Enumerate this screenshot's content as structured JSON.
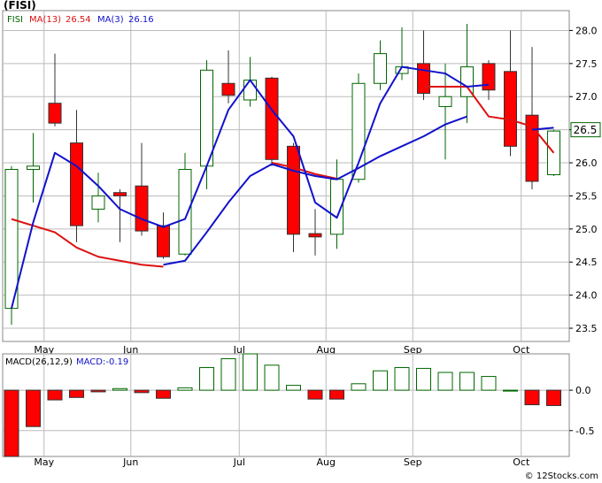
{
  "chart_data": [
    {
      "type": "candlestick",
      "title": "(FISI)",
      "legend": {
        "symbol": "FISI",
        "ma13_label": "MA(13)",
        "ma13_value": "26.54",
        "ma3_label": "MA(3)",
        "ma3_value": "26.16"
      },
      "last_price_label": "26.5",
      "ylim": [
        23.3,
        28.3
      ],
      "y_ticks": [
        {
          "value": 23.5,
          "label": "23.5"
        },
        {
          "value": 24.0,
          "label": "24.0"
        },
        {
          "value": 24.5,
          "label": "24.5"
        },
        {
          "value": 25.0,
          "label": "25.0"
        },
        {
          "value": 25.5,
          "label": "25.5"
        },
        {
          "value": 26.0,
          "label": "26.0"
        },
        {
          "value": 26.5,
          "label": "26.5"
        },
        {
          "value": 27.0,
          "label": "27.0"
        },
        {
          "value": 27.5,
          "label": "27.5"
        },
        {
          "value": 28.0,
          "label": "28.0"
        }
      ],
      "x_labels": [
        {
          "label": "May",
          "index": 1
        },
        {
          "label": "Jun",
          "index": 5
        },
        {
          "label": "Jul",
          "index": 10
        },
        {
          "label": "Aug",
          "index": 14
        },
        {
          "label": "Sep",
          "index": 18
        },
        {
          "label": "Oct",
          "index": 23
        }
      ],
      "candles": [
        {
          "o": 23.8,
          "h": 25.95,
          "l": 23.55,
          "c": 25.9
        },
        {
          "o": 25.9,
          "h": 26.45,
          "l": 25.4,
          "c": 25.95
        },
        {
          "o": 26.9,
          "h": 27.65,
          "l": 26.55,
          "c": 26.6
        },
        {
          "o": 26.3,
          "h": 26.8,
          "l": 24.8,
          "c": 25.05
        },
        {
          "o": 25.3,
          "h": 25.85,
          "l": 25.1,
          "c": 25.5
        },
        {
          "o": 25.55,
          "h": 25.6,
          "l": 24.8,
          "c": 25.5
        },
        {
          "o": 25.65,
          "h": 26.3,
          "l": 24.9,
          "c": 24.97
        },
        {
          "o": 25.05,
          "h": 25.25,
          "l": 24.55,
          "c": 24.58
        },
        {
          "o": 24.62,
          "h": 26.15,
          "l": 24.6,
          "c": 25.9
        },
        {
          "o": 25.95,
          "h": 27.55,
          "l": 25.6,
          "c": 27.4
        },
        {
          "o": 27.2,
          "h": 27.7,
          "l": 26.9,
          "c": 27.02
        },
        {
          "o": 26.95,
          "h": 27.6,
          "l": 26.85,
          "c": 27.25
        },
        {
          "o": 27.28,
          "h": 27.3,
          "l": 25.95,
          "c": 26.05
        },
        {
          "o": 26.25,
          "h": 26.3,
          "l": 24.65,
          "c": 24.92
        },
        {
          "o": 24.93,
          "h": 25.3,
          "l": 24.6,
          "c": 24.88
        },
        {
          "o": 24.92,
          "h": 26.05,
          "l": 24.7,
          "c": 25.75
        },
        {
          "o": 25.75,
          "h": 27.35,
          "l": 25.7,
          "c": 27.2
        },
        {
          "o": 27.2,
          "h": 27.85,
          "l": 27.1,
          "c": 27.65
        },
        {
          "o": 27.35,
          "h": 28.05,
          "l": 27.25,
          "c": 27.45
        },
        {
          "o": 27.5,
          "h": 28.0,
          "l": 26.95,
          "c": 27.05
        },
        {
          "o": 26.85,
          "h": 27.5,
          "l": 26.05,
          "c": 27.0
        },
        {
          "o": 27.0,
          "h": 28.1,
          "l": 26.6,
          "c": 27.45
        },
        {
          "o": 27.5,
          "h": 27.55,
          "l": 26.95,
          "c": 27.1
        },
        {
          "o": 27.38,
          "h": 28.0,
          "l": 26.1,
          "c": 26.25
        },
        {
          "o": 26.72,
          "h": 27.75,
          "l": 25.6,
          "c": 25.72
        },
        {
          "o": 25.82,
          "h": 26.5,
          "l": 25.8,
          "c": 26.48
        }
      ],
      "series": [
        {
          "name": "MA(13)",
          "color": "#dd1111",
          "values": [
            25.15,
            25.05,
            24.95,
            24.72,
            24.58,
            24.52,
            24.46,
            24.43,
            null,
            null,
            null,
            null,
            26.0,
            25.93,
            25.83,
            25.76,
            null,
            null,
            null,
            27.15,
            27.15,
            27.15,
            26.7,
            26.65,
            26.55,
            26.15
          ]
        },
        {
          "name": "MA(3)",
          "color": "#1111cc",
          "values": [
            23.8,
            25.1,
            26.15,
            25.95,
            25.65,
            25.3,
            25.15,
            25.03,
            25.15,
            25.95,
            26.8,
            27.25,
            26.8,
            26.4,
            25.4,
            25.17,
            26.0,
            26.9,
            27.45,
            27.4,
            27.35,
            27.15,
            27.18,
            null,
            26.5,
            26.53
          ]
        },
        {
          "name": "",
          "color": "#1111cc",
          "values": [
            null,
            null,
            null,
            null,
            null,
            null,
            null,
            24.46,
            24.52,
            24.95,
            25.4,
            25.8,
            25.98,
            25.88,
            25.8,
            25.75,
            25.92,
            26.1,
            26.25,
            26.4,
            26.58,
            26.7,
            null,
            null,
            null,
            null
          ]
        }
      ]
    },
    {
      "type": "bar",
      "title": "MACD(26,12,9)",
      "legend_text": "MACD:-0.19",
      "ylim": [
        -0.82,
        0.45
      ],
      "y_ticks": [
        {
          "value": 0.0,
          "label": "0.0"
        },
        {
          "value": -0.5,
          "label": "-0.5"
        }
      ],
      "x_labels": [
        {
          "label": "May",
          "index": 1
        },
        {
          "label": "Jun",
          "index": 5
        },
        {
          "label": "Jul",
          "index": 10
        },
        {
          "label": "Aug",
          "index": 14
        },
        {
          "label": "Sep",
          "index": 18
        },
        {
          "label": "Oct",
          "index": 23
        }
      ],
      "values": [
        -0.82,
        -0.45,
        -0.12,
        -0.09,
        -0.02,
        0.02,
        -0.03,
        -0.1,
        0.03,
        0.28,
        0.39,
        0.45,
        0.31,
        0.06,
        -0.11,
        -0.11,
        0.08,
        0.24,
        0.28,
        0.27,
        0.22,
        0.22,
        0.17,
        0.0,
        -0.18,
        -0.19
      ]
    }
  ],
  "watermark": "© 12Stocks.com",
  "colors": {
    "up": "#006600",
    "down": "#ff0000",
    "grid": "#bbbbbb",
    "frame": "#888888"
  }
}
